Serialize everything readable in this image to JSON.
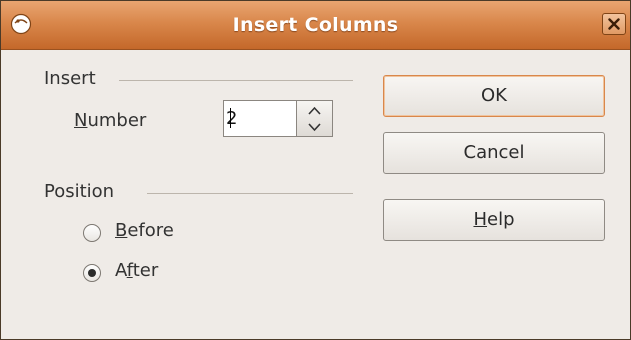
{
  "window": {
    "title": "Insert Columns",
    "titlebar_color": "#d9874b"
  },
  "insert_group": {
    "label": "Insert",
    "number_label": {
      "mnemonic": "N",
      "rest": "umber"
    },
    "number_value": "2"
  },
  "position_group": {
    "label": "Position",
    "options": [
      {
        "mnemonic": "B",
        "rest": "efore",
        "selected": false
      },
      {
        "pre": "A",
        "mnemonic": "f",
        "rest": "ter",
        "selected": true
      }
    ]
  },
  "buttons": {
    "ok": "OK",
    "cancel": "Cancel",
    "help": {
      "mnemonic": "H",
      "rest": "elp"
    }
  },
  "icons": {
    "window_menu": "window-menu-icon",
    "close": "close-icon",
    "spin_up": "spin-up-icon",
    "spin_down": "spin-down-icon"
  }
}
